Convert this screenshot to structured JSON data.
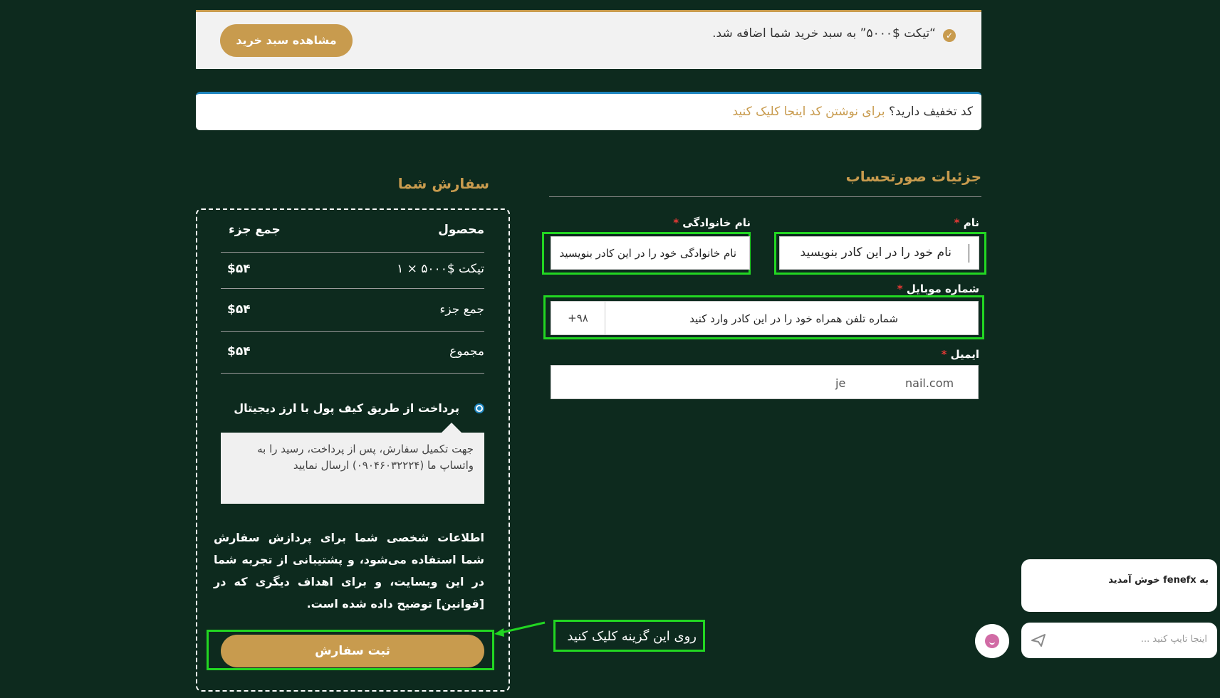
{
  "notice": {
    "message": "“تیکت $۵۰۰۰” به سبد خرید شما اضافه شد.",
    "view_cart_label": "مشاهده سبد خرید"
  },
  "coupon": {
    "question": "کد تخفیف دارید؟",
    "link": "برای نوشتن کد اینجا کلیک کنید"
  },
  "billing": {
    "heading": "جزئیات صورتحساب",
    "first_name": {
      "label": "نام",
      "placeholder": "نام خود را در این کادر بنویسید"
    },
    "last_name": {
      "label": "نام خانوادگی",
      "placeholder": "نام خانوادگی خود را در این کادر بنویسید"
    },
    "mobile": {
      "label": "شماره موبایل",
      "country_code": "+۹۸",
      "placeholder": "شماره تلفن همراه خود را در این کادر وارد کنید"
    },
    "email": {
      "label": "ایمیل",
      "value_part1": "je",
      "value_part2": "nail.com"
    },
    "required_mark": "*"
  },
  "order": {
    "heading": "سفارش شما",
    "col_product": "محصول",
    "col_subtotal": "جمع جزء",
    "item_name": "تیکت $۵۰۰۰ × ۱",
    "item_price": "$۵۴",
    "subtotal_label": "جمع جزء",
    "subtotal_value": "$۵۴",
    "total_label": "مجموع",
    "total_value": "$۵۴",
    "payment_method": "پرداخت از طریق کیف پول با ارز دیجیتال",
    "payment_description": "جهت تکمیل سفارش، پس از پرداخت، رسید را به واتساپ ما (۰۹۰۴۶۰۳۲۲۲۴) ارسال نمایید",
    "privacy_text": "اطلاعات شخصی شما برای پردازش سفارش شما استفاده می‌شود، و پشتیبانی از تجربه شما در این وبسایت، و برای اهداف دیگری که در [قوانین] توضیح داده شده است.",
    "submit_label": "ثبت سفارش"
  },
  "annotation": {
    "callout": "روی این گزینه کلیک کنید",
    "highlight_color": "#22d622"
  },
  "chat": {
    "welcome": "به fenefx خوش آمدید",
    "placeholder": "اینجا تایپ کنید ..."
  },
  "colors": {
    "background": "#0d2a1e",
    "accent": "#c89b4e",
    "info": "#1e85be"
  }
}
